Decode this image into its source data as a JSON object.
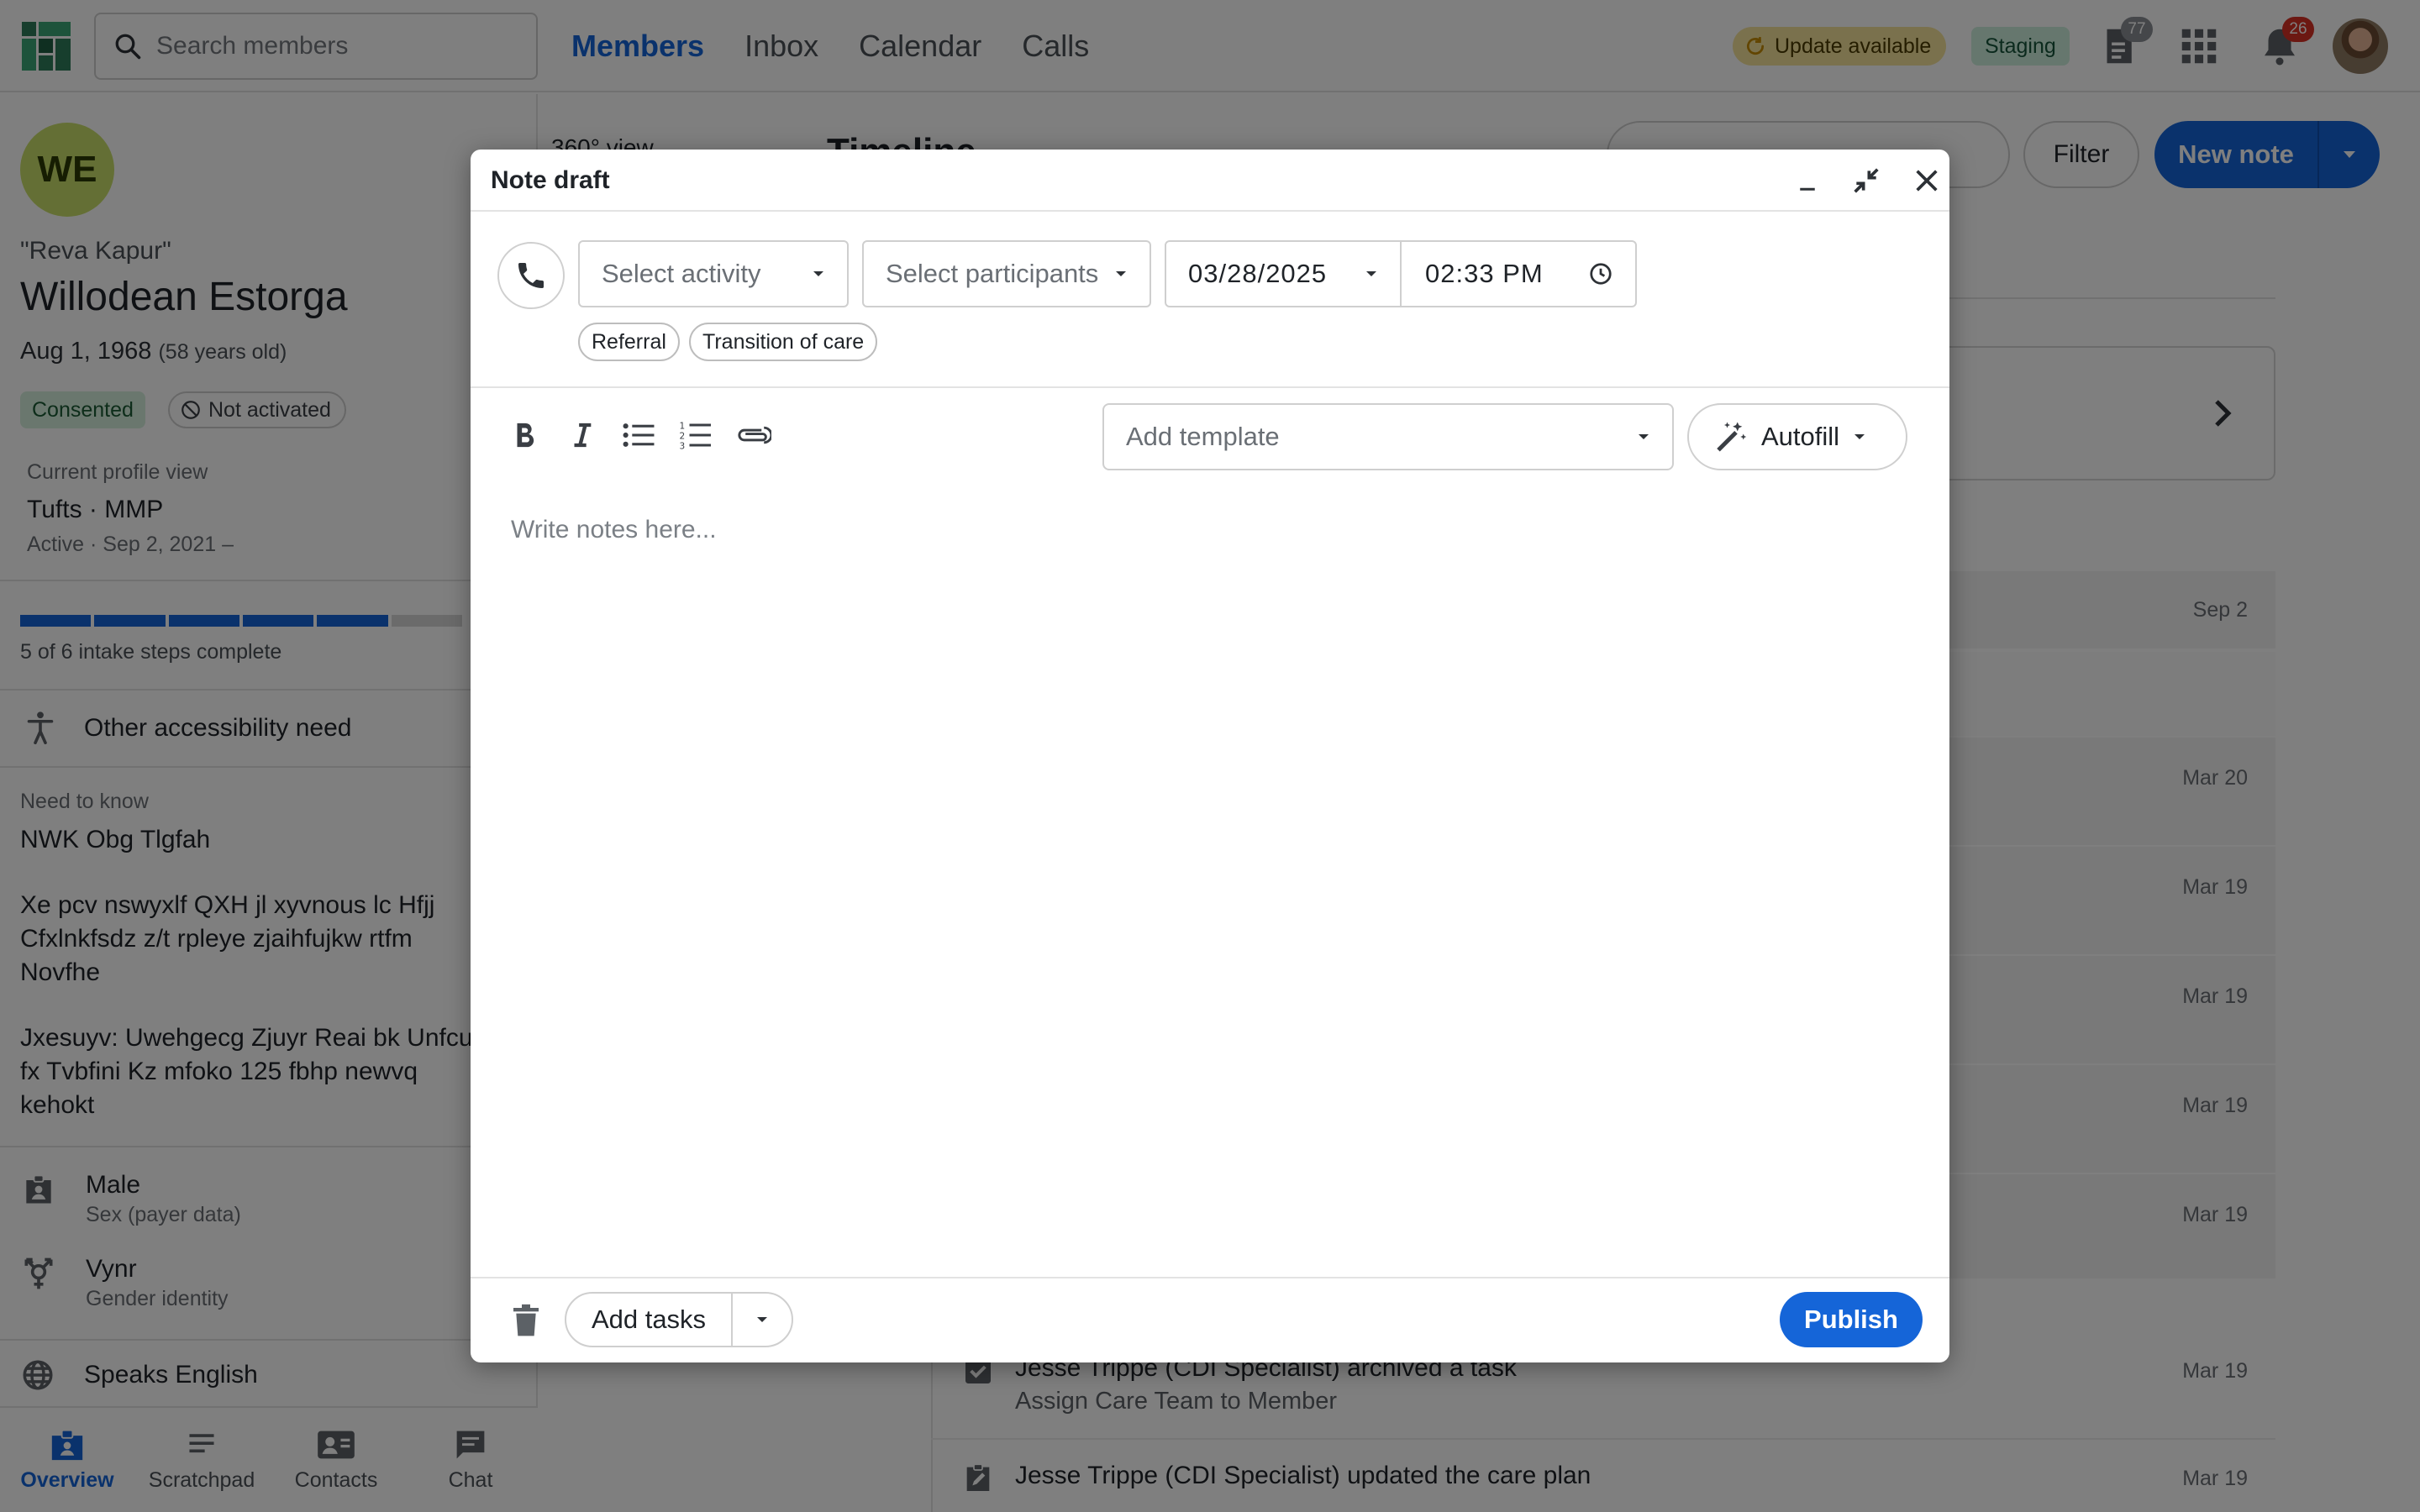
{
  "topbar": {
    "search_placeholder": "Search members",
    "nav": [
      "Members",
      "Inbox",
      "Calendar",
      "Calls"
    ],
    "active_nav": "Members",
    "update_label": "Update available",
    "env_label": "Staging",
    "docs_count": "77",
    "notifications_count": "26",
    "colors": {
      "accent": "#1565d8",
      "badge": "#d93025",
      "docs_badge": "#8a8f95"
    }
  },
  "member": {
    "initials": "WE",
    "preferred_name": "\"Reva Kapur\"",
    "name": "Willodean Estorga",
    "dob": "Aug 1, 1968",
    "age": "(58 years old)",
    "consent_status": "Consented",
    "activation_status": "Not activated",
    "profile_view_label": "Current profile view",
    "profile_view": "Tufts · MMP",
    "profile_active": "Active · Sep 2, 2021 –",
    "intake_completed": 5,
    "intake_total": 6,
    "intake_text": "5 of 6 intake steps complete",
    "accessibility": "Other accessibility need",
    "need_to_know_label": "Need to know",
    "need_to_know": [
      "NWK Obg Tlgfah",
      "Xe pcv nswyxlf QXH jl xyvnous lc Hfjj Cfxlnkfsdz z/t rpleye zjaihfujkw rtfm Novfhe",
      "Jxesuyv: Uwehgecg Zjuyr Reai bk Unfcu fx Tvbfini Kz mfoko 125 fbhp newvq kehokt"
    ],
    "sex": "Male",
    "sex_label": "Sex (payer data)",
    "gender": "Vynr",
    "gender_label": "Gender identity",
    "language": "Speaks English"
  },
  "bottom_nav": [
    "Overview",
    "Scratchpad",
    "Contacts",
    "Chat"
  ],
  "timeline": {
    "view_label": "360° view",
    "title": "Timeline",
    "filter_label": "Filter",
    "new_note_label": "New note",
    "dates": [
      "Sep 2",
      "Mar 20",
      "Mar 19",
      "Mar 19",
      "Mar 19",
      "Mar 19",
      "Mar 19",
      "Mar 19"
    ],
    "events": [
      {
        "text": "Jesse Trippe (CDI Specialist) archived a task",
        "sub": "Assign Care Team to Member",
        "date": "Mar 19"
      },
      {
        "text": "Jesse Trippe (CDI Specialist) updated the care plan",
        "sub": "",
        "date": "Mar 19"
      }
    ]
  },
  "note_draft": {
    "title": "Note draft",
    "activity_placeholder": "Select activity",
    "participants_placeholder": "Select participants",
    "date": "03/28/2025",
    "time": "02:33 PM",
    "tags": [
      "Referral",
      "Transition of care"
    ],
    "template_placeholder": "Add template",
    "autofill_label": "Autofill",
    "notes_placeholder": "Write notes here...",
    "add_tasks_label": "Add tasks",
    "publish_label": "Publish"
  }
}
